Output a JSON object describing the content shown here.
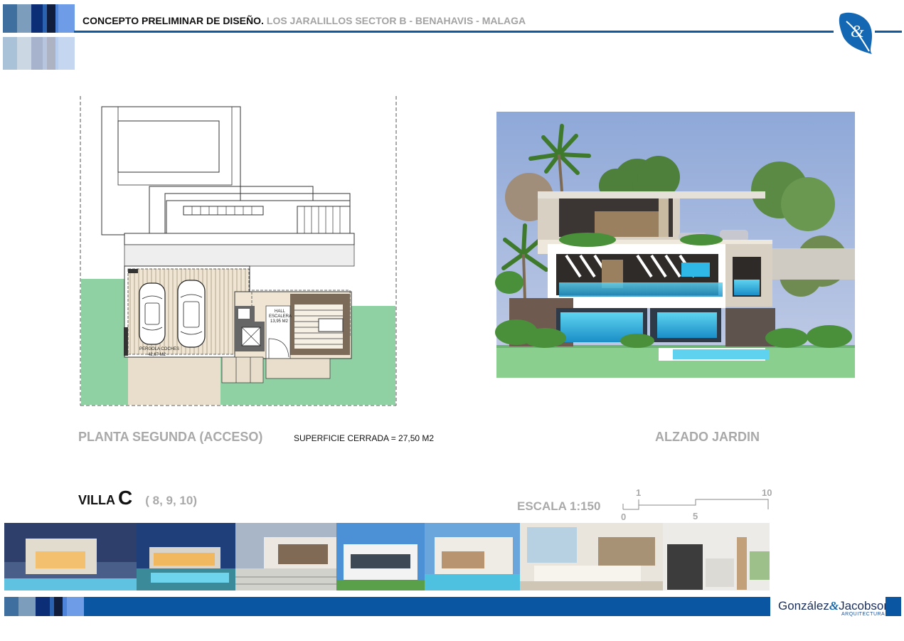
{
  "header": {
    "title": "CONCEPTO PRELIMINAR DE DISEÑO.",
    "subtitle": "LOS JARALILLOS SECTOR B - BENAHAVIS - MALAGA"
  },
  "plan": {
    "caption": "PLANTA SEGUNDA (ACCESO)",
    "surface_note": "SUPERFICIE CERRADA = 27,50 M2",
    "room_pergola": "PERGOLA COCHES",
    "room_pergola_area": "42,67 M2",
    "room_hall_1": "HALL",
    "room_hall_2": "ESCALERA",
    "room_hall_area": "13,95 M2"
  },
  "elevation": {
    "caption": "ALZADO JARDIN"
  },
  "villa": {
    "word": "VILLA",
    "letter": "C",
    "numbers": "( 8, 9, 10)"
  },
  "scale": {
    "label": "ESCALA 1:150",
    "ticks": [
      "0",
      "1",
      "5",
      "10"
    ]
  },
  "photos": [
    {
      "name": "exterior-dusk-pool"
    },
    {
      "name": "exterior-night-pool"
    },
    {
      "name": "terrace-deck"
    },
    {
      "name": "exterior-day-white"
    },
    {
      "name": "exterior-pool-pergola"
    },
    {
      "name": "interior-living-room"
    },
    {
      "name": "interior-kitchen"
    }
  ],
  "footer": {
    "logo_left": "González",
    "logo_right": "Jacobson",
    "logo_sub": "ARQUITECTURA"
  },
  "colors": {
    "brand_blue": "#0a56a3",
    "grey_text": "#a9a9a9",
    "lawn_green": "#8fd1a3"
  }
}
